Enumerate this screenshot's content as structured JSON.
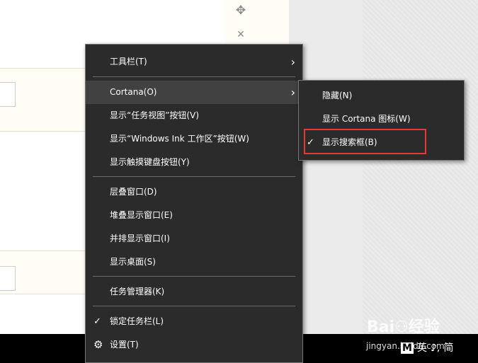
{
  "background": {
    "move_icon": "move-icon",
    "close_icon": "close-icon"
  },
  "main_menu": {
    "items": [
      {
        "label": "工具栏(T)",
        "has_submenu": true
      },
      {
        "label": "Cortana(O)",
        "has_submenu": true,
        "highlighted": true
      },
      {
        "label": "显示“任务视图”按钮(V)"
      },
      {
        "label": "显示“Windows Ink 工作区”按钮(W)"
      },
      {
        "label": "显示触摸键盘按钮(Y)"
      },
      {
        "label": "层叠窗口(D)"
      },
      {
        "label": "堆叠显示窗口(E)"
      },
      {
        "label": "并排显示窗口(I)"
      },
      {
        "label": "显示桌面(S)"
      },
      {
        "label": "任务管理器(K)"
      },
      {
        "label": "锁定任务栏(L)",
        "checked": true
      },
      {
        "label": "设置(T)",
        "icon": "gear-icon"
      }
    ]
  },
  "sub_menu": {
    "items": [
      {
        "label": "隐藏(N)"
      },
      {
        "label": "显示 Cortana 图标(W)"
      },
      {
        "label": "显示搜索框(B)",
        "checked": true
      }
    ]
  },
  "taskbar": {
    "ime_mode": "M",
    "ime_lang": "英",
    "ime_punct": "♪,",
    "ime_script": "简"
  },
  "watermark": {
    "logo": "Bai⚇经验",
    "url": "jingyan.baidu.com"
  },
  "colors": {
    "menu_bg": "#2b2b2b",
    "menu_highlight": "#414141",
    "annotation_box": "#e53935",
    "taskbar": "#000000"
  }
}
